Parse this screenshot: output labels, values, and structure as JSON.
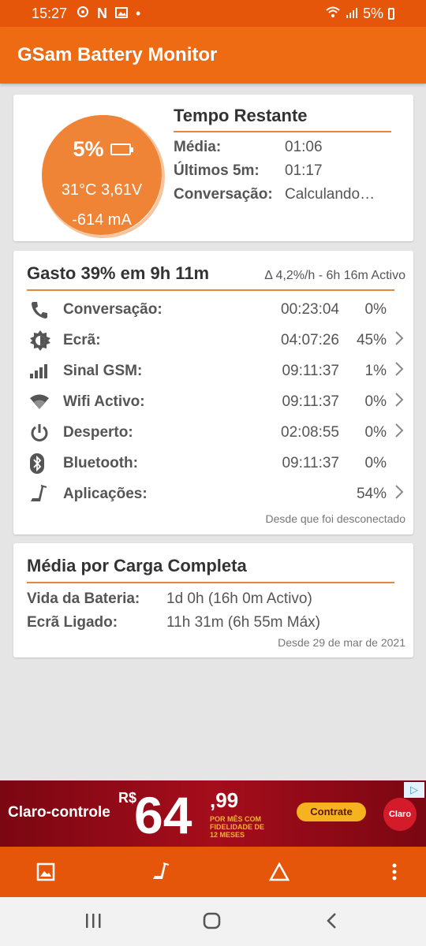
{
  "status_bar": {
    "time": "15:27",
    "battery_text": "5%",
    "icons": [
      "sync-icon",
      "netflix-icon",
      "image-icon",
      "dot-icon",
      "wifi-icon",
      "signal-icon",
      "battery-icon"
    ]
  },
  "app_bar": {
    "title": "GSam Battery Monitor"
  },
  "card_time": {
    "gauge": {
      "percent": "5%",
      "temp_voltage": "31°C  3,61V",
      "current": "-614 mA",
      "level_fraction": 0.05
    },
    "title": "Tempo Restante",
    "rows": [
      {
        "label": "Média:",
        "value": "01:06"
      },
      {
        "label": "Últimos 5m:",
        "value": "01:17"
      },
      {
        "label": "Conversação:",
        "value": "Calculando…"
      }
    ]
  },
  "card_usage": {
    "title": "Gasto 39% em 9h 11m",
    "subtitle": "Δ 4,2%/h - 6h 16m Activo",
    "rows": [
      {
        "icon": "phone-icon",
        "label": "Conversação:",
        "time": "00:23:04",
        "pct": "0%",
        "chevron": false
      },
      {
        "icon": "screen-brightness-icon",
        "label": "Ecrã:",
        "time": "04:07:26",
        "pct": "45%",
        "chevron": true
      },
      {
        "icon": "signal-bars-icon",
        "label": "Sinal GSM:",
        "time": "09:11:37",
        "pct": "1%",
        "chevron": true
      },
      {
        "icon": "wifi-icon",
        "label": "Wifi Activo:",
        "time": "09:11:37",
        "pct": "0%",
        "chevron": true
      },
      {
        "icon": "power-icon",
        "label": "Desperto:",
        "time": "02:08:55",
        "pct": "0%",
        "chevron": true
      },
      {
        "icon": "bluetooth-icon",
        "label": "Bluetooth:",
        "time": "09:11:37",
        "pct": "0%",
        "chevron": false
      },
      {
        "icon": "apps-icon",
        "label": "Aplicações:",
        "time": "",
        "pct": "54%",
        "chevron": true
      }
    ],
    "footnote": "Desde que foi desconectado"
  },
  "card_average": {
    "title": "Média por Carga Completa",
    "rows": [
      {
        "label": "Vida da Bateria:",
        "value": "1d 0h (16h 0m Activo)"
      },
      {
        "label": "Ecrã Ligado:",
        "value": "11h 31m (6h 55m Máx)"
      }
    ],
    "footnote": "Desde 29 de mar de 2021"
  },
  "ad": {
    "brand": "Claro-controle",
    "currency": "R$",
    "price_int": "64",
    "price_cents": ",99",
    "fine_print": "POR MÊS COM FIDELIDADE DE 12 MESES",
    "cta": "Contrate",
    "logo": "Claro"
  },
  "toolbar": {
    "icons": [
      "image-icon",
      "apps-icon",
      "delta-icon",
      "more-vert-icon"
    ]
  },
  "nav": {
    "icons": [
      "recents-icon",
      "home-icon",
      "back-icon"
    ]
  }
}
